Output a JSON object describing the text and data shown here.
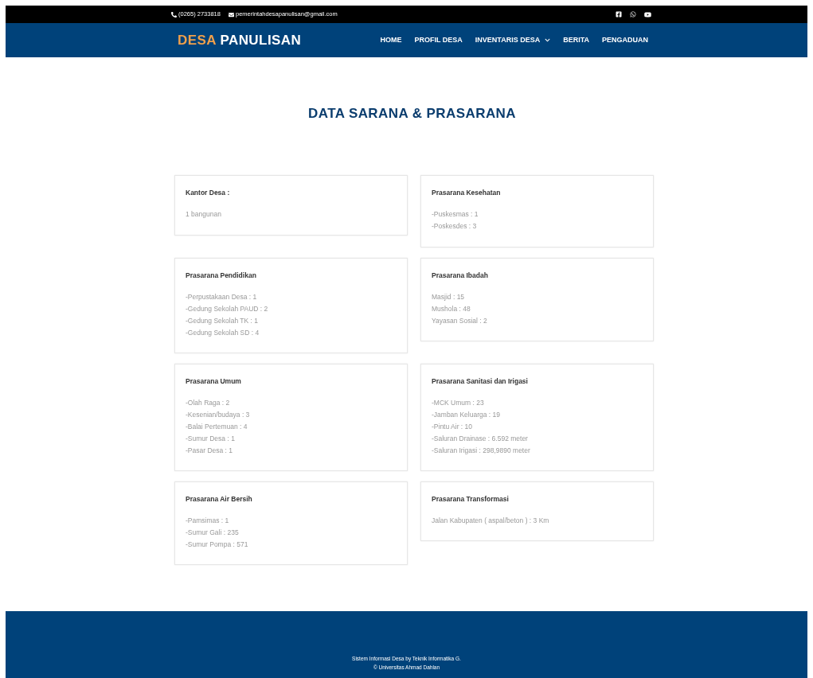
{
  "topbar": {
    "phone": "(0265) 2733818",
    "email": "pemerintahdesapanulisan@gmail.com"
  },
  "brand": {
    "accent": "DESA",
    "rest": "PANULISAN"
  },
  "nav": [
    {
      "label": "HOME",
      "dropdown": false
    },
    {
      "label": "PROFIL DESA",
      "dropdown": false
    },
    {
      "label": "INVENTARIS DESA",
      "dropdown": true
    },
    {
      "label": "BERITA",
      "dropdown": false
    },
    {
      "label": "PENGADUAN",
      "dropdown": false
    }
  ],
  "page_title": "DATA SARANA & PRASARANA",
  "cards": [
    {
      "title": "Kantor Desa :",
      "items": [
        "1 bangunan"
      ]
    },
    {
      "title": "Prasarana Kesehatan",
      "items": [
        "-Puskesmas : 1",
        "-Poskesdes : 3"
      ]
    },
    {
      "title": "Prasarana Pendidikan",
      "items": [
        "-Perpustakaan Desa : 1",
        "-Gedung Sekolah PAUD : 2",
        "-Gedung Sekolah TK : 1",
        "-Gedung Sekolah SD : 4"
      ]
    },
    {
      "title": "Prasarana Ibadah",
      "items": [
        "Masjid : 15",
        "Mushola : 48",
        "Yayasan Sosial : 2"
      ]
    },
    {
      "title": "Prasarana Umum",
      "items": [
        "-Olah Raga : 2",
        "-Kesenian/budaya : 3",
        "-Balai Pertemuan : 4",
        "-Sumur Desa : 1",
        "-Pasar Desa : 1"
      ]
    },
    {
      "title": "Prasarana Sanitasi dan Irigasi",
      "items": [
        "-MCK Umum : 23",
        "-Jamban Keluarga : 19",
        "-Pintu Air : 10",
        "-Saluran Drainase : 6.592 meter",
        "-Saluran Irigasi : 298,9890 meter"
      ]
    },
    {
      "title": "Prasarana Air Bersih",
      "items": [
        "-Pamsimas : 1",
        "-Sumur Gali : 235",
        "-Sumur Pompa : 571"
      ]
    },
    {
      "title": "Prasarana Transformasi",
      "items": [
        "Jalan Kabupaten ( aspal/beton ) : 3 Km"
      ]
    }
  ],
  "footer": [
    "Sistem Informasi Desa by Teknik Informatika G.",
    "© Universitas Ahmad Dahlan"
  ]
}
